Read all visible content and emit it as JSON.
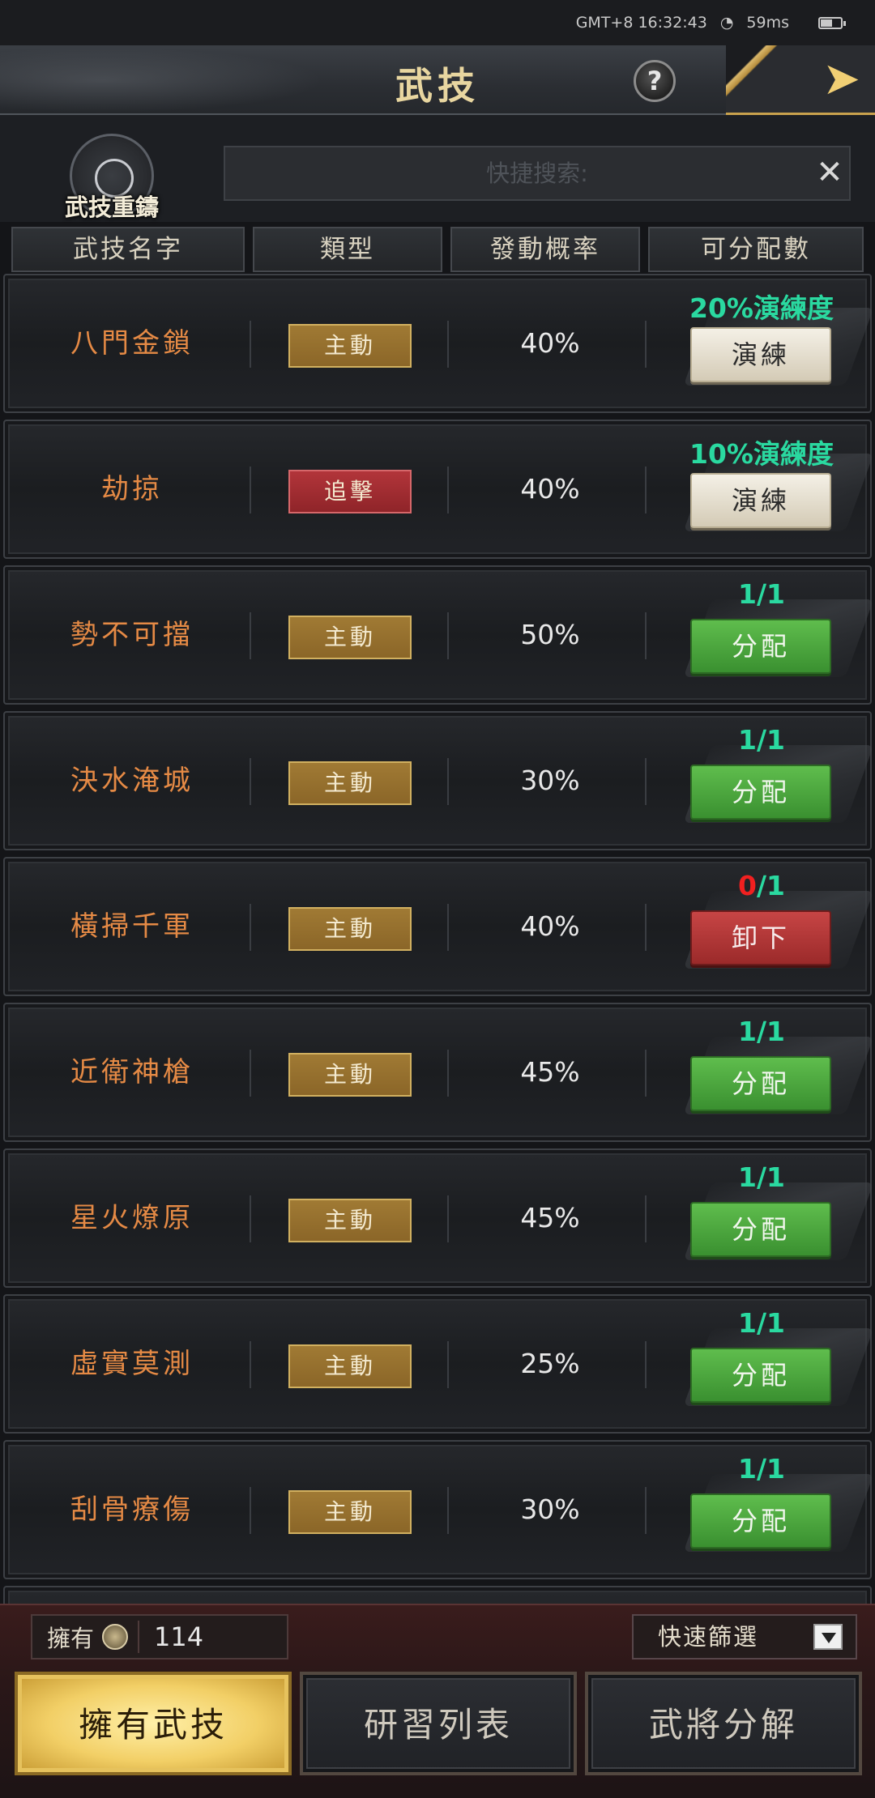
{
  "status_bar": {
    "clock": "GMT+8 16:32:43",
    "ping": "59ms"
  },
  "header": {
    "title": "武技",
    "help_label": "?",
    "back_label": "➤"
  },
  "recast": {
    "label": "武技重鑄"
  },
  "search": {
    "placeholder": "快捷搜索:",
    "value": "",
    "clear_label": "✕"
  },
  "columns": [
    "武技名字",
    "類型",
    "發動概率",
    "可分配數"
  ],
  "skills": [
    {
      "name": "八門金鎖",
      "type": "主動",
      "type_kind": "active",
      "rate": "40%",
      "status": "20%演練度",
      "button": "演練",
      "button_kind": "practice"
    },
    {
      "name": "劫掠",
      "type": "追擊",
      "type_kind": "chase",
      "rate": "40%",
      "status": "10%演練度",
      "button": "演練",
      "button_kind": "practice"
    },
    {
      "name": "勢不可擋",
      "type": "主動",
      "type_kind": "active",
      "rate": "50%",
      "status": "1/1",
      "button": "分配",
      "button_kind": "assign"
    },
    {
      "name": "決水淹城",
      "type": "主動",
      "type_kind": "active",
      "rate": "30%",
      "status": "1/1",
      "button": "分配",
      "button_kind": "assign"
    },
    {
      "name": "橫掃千軍",
      "type": "主動",
      "type_kind": "active",
      "rate": "40%",
      "status_used": "0",
      "status_rest": "/1",
      "button": "卸下",
      "button_kind": "unload"
    },
    {
      "name": "近衛神槍",
      "type": "主動",
      "type_kind": "active",
      "rate": "45%",
      "status": "1/1",
      "button": "分配",
      "button_kind": "assign"
    },
    {
      "name": "星火燎原",
      "type": "主動",
      "type_kind": "active",
      "rate": "45%",
      "status": "1/1",
      "button": "分配",
      "button_kind": "assign"
    },
    {
      "name": "虛實莫測",
      "type": "主動",
      "type_kind": "active",
      "rate": "25%",
      "status": "1/1",
      "button": "分配",
      "button_kind": "assign"
    },
    {
      "name": "刮骨療傷",
      "type": "主動",
      "type_kind": "active",
      "rate": "30%",
      "status": "1/1",
      "button": "分配",
      "button_kind": "assign"
    }
  ],
  "footer": {
    "own_label": "擁有",
    "own_count": "114",
    "filter_label": "快速篩選",
    "tabs": [
      "擁有武技",
      "研習列表",
      "武將分解"
    ]
  }
}
